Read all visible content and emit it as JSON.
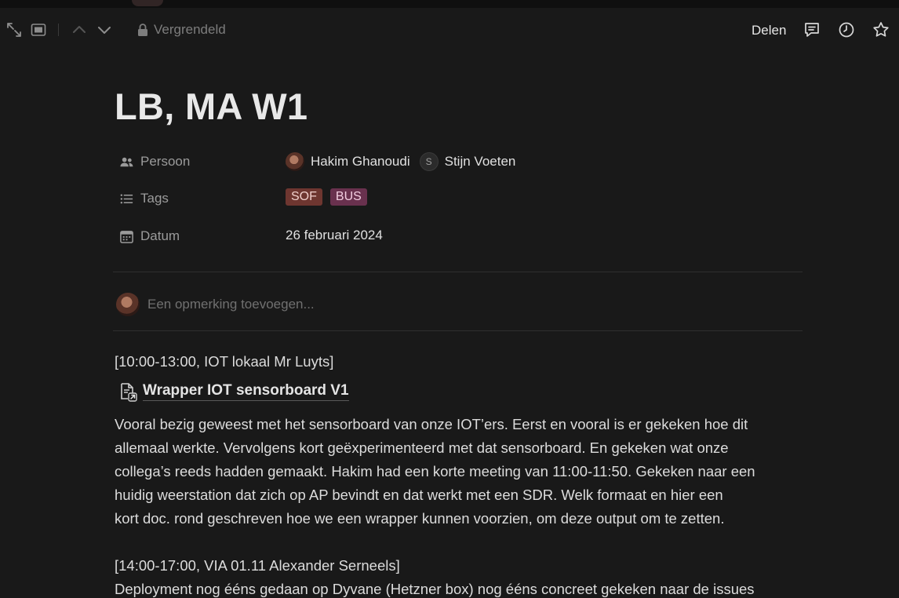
{
  "topbar": {
    "lock_label": "Vergrendeld",
    "share_label": "Delen",
    "icons": [
      "expand-icon",
      "peek-mode-icon",
      "chevron-up-icon",
      "chevron-down-icon",
      "lock-icon",
      "comment-icon",
      "history-icon",
      "star-icon"
    ]
  },
  "page": {
    "title": "LB, MA W1"
  },
  "properties": {
    "person": {
      "label": "Persoon",
      "people": [
        {
          "name": "Hakim Ghanoudi"
        },
        {
          "initial": "S",
          "name": "Stijn Voeten"
        }
      ]
    },
    "tags": {
      "label": "Tags",
      "items": [
        {
          "label": "SOF",
          "color": "#6e3630"
        },
        {
          "label": "BUS",
          "color": "#69314e"
        }
      ]
    },
    "date": {
      "label": "Datum",
      "value": "26 februari 2024"
    }
  },
  "comment": {
    "placeholder": "Een opmerking toevoegen..."
  },
  "content": {
    "block1_time": "[10:00-13:00, IOT lokaal Mr Luyts]",
    "link_title": "Wrapper IOT sensorboard V1",
    "paragraph1_lines": [
      "Vooral bezig geweest met het sensorboard van onze IOT’ers. Eerst en vooral is er gekeken hoe dit",
      "allemaal werkte. Vervolgens kort geëxperimenteerd met dat sensorboard. En gekeken wat onze",
      "collega’s reeds hadden gemaakt. Hakim had een korte meeting van 11:00-11:50. Gekeken naar een",
      "huidig weerstation dat zich op AP bevindt en dat werkt met een SDR. Welk formaat en hier een",
      "kort doc. rond geschreven hoe we een wrapper kunnen voorzien, om deze output om te zetten."
    ],
    "block2_time": "[14:00-17:00, VIA 01.11 Alexander Serneels]",
    "paragraph2_partial": "Deployment nog ééns gedaan op Dyvane (Hetzner box) nog ééns concreet gekeken naar de issues"
  }
}
